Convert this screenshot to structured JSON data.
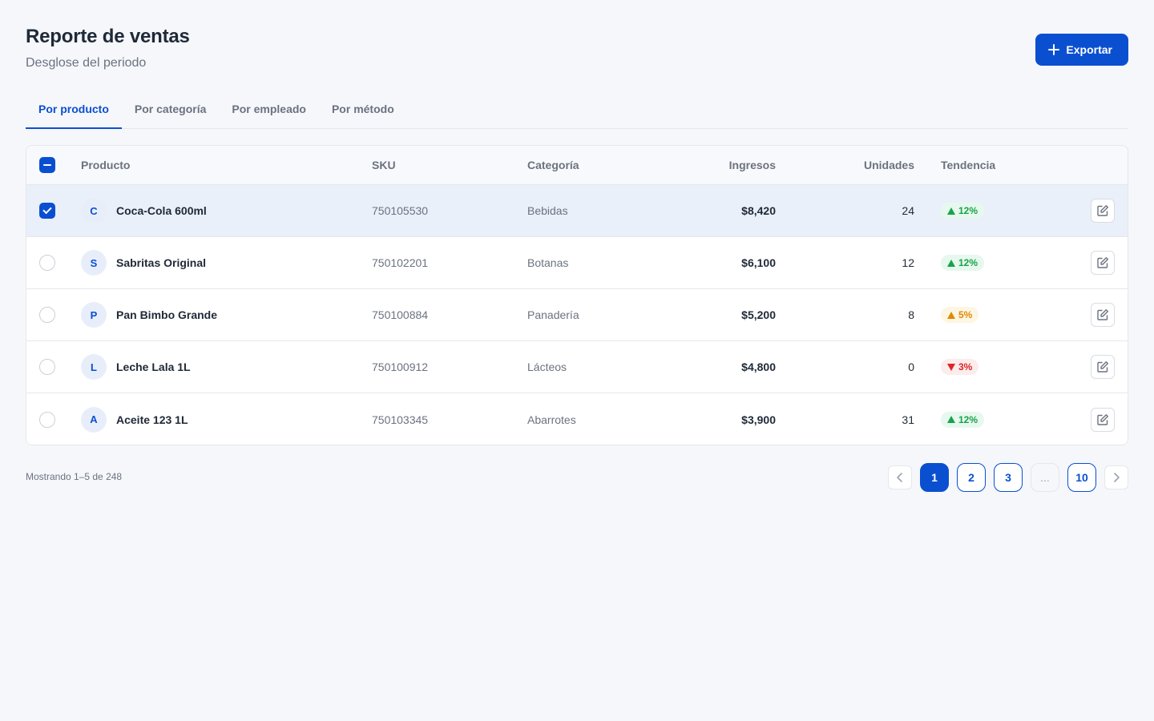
{
  "header": {
    "title": "Reporte de ventas",
    "subtitle": "Desglose del periodo",
    "export_label": "Exportar"
  },
  "tabs": [
    {
      "label": "Por producto",
      "active": true
    },
    {
      "label": "Por categoría",
      "active": false
    },
    {
      "label": "Por empleado",
      "active": false
    },
    {
      "label": "Por método",
      "active": false
    }
  ],
  "table": {
    "columns": {
      "product": "Producto",
      "sku": "SKU",
      "category": "Categoría",
      "revenue": "Ingresos",
      "units": "Unidades",
      "trend": "Tendencia"
    },
    "rows": [
      {
        "initial": "C",
        "name": "Coca-Cola 600ml",
        "sku": "750105530",
        "category": "Bebidas",
        "revenue": "$8,420",
        "units": "24",
        "trend": "12%",
        "trend_dir": "up",
        "selected": true
      },
      {
        "initial": "S",
        "name": "Sabritas Original",
        "sku": "750102201",
        "category": "Botanas",
        "revenue": "$6,100",
        "units": "12",
        "trend": "12%",
        "trend_dir": "up",
        "selected": false
      },
      {
        "initial": "P",
        "name": "Pan Bimbo Grande",
        "sku": "750100884",
        "category": "Panadería",
        "revenue": "$5,200",
        "units": "8",
        "trend": "5%",
        "trend_dir": "warn",
        "selected": false
      },
      {
        "initial": "L",
        "name": "Leche Lala 1L",
        "sku": "750100912",
        "category": "Lácteos",
        "revenue": "$4,800",
        "units": "0",
        "trend": "3%",
        "trend_dir": "down",
        "selected": false
      },
      {
        "initial": "A",
        "name": "Aceite 123 1L",
        "sku": "750103345",
        "category": "Abarrotes",
        "revenue": "$3,900",
        "units": "31",
        "trend": "12%",
        "trend_dir": "up",
        "selected": false
      }
    ]
  },
  "footer": {
    "showing": "Mostrando 1–5 de 248",
    "pages": [
      "1",
      "2",
      "3",
      "...",
      "10"
    ],
    "current_page": "1"
  },
  "colors": {
    "accent": "#0b4fd1",
    "trend_up": "#16a34a",
    "trend_warn": "#e08a00",
    "trend_down": "#dc2626"
  },
  "icons": {
    "export": "plus-icon",
    "row_action": "edit-icon",
    "prev": "chevron-left-icon",
    "next": "chevron-right-icon"
  }
}
